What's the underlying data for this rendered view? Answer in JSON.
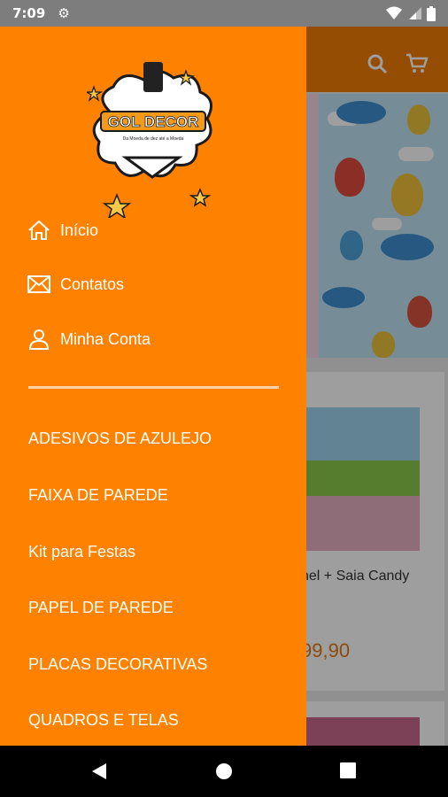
{
  "status_bar": {
    "time": "7:09",
    "icons": [
      "gear-icon",
      "wifi-icon",
      "signal-icon",
      "battery-icon"
    ]
  },
  "toolbar": {
    "icons": [
      "search-icon",
      "cart-icon"
    ]
  },
  "background": {
    "product_title": "nel + Saia Candy",
    "product_price": "99,90"
  },
  "drawer": {
    "logo_text": "GOL DECOR",
    "logo_tagline": "Da Moeda de dez até a Moeda",
    "nav": [
      {
        "label": "Início",
        "icon": "home-icon"
      },
      {
        "label": "Contatos",
        "icon": "mail-icon"
      },
      {
        "label": "Minha Conta",
        "icon": "person-icon"
      }
    ],
    "categories": [
      {
        "label": "ADESIVOS DE AZULEJO"
      },
      {
        "label": "FAIXA DE PAREDE"
      },
      {
        "label": "Kit para Festas"
      },
      {
        "label": "PAPEL DE PAREDE"
      },
      {
        "label": "PLACAS DECORATIVAS"
      },
      {
        "label": "QUADROS E TELAS"
      }
    ]
  },
  "colors": {
    "drawer_bg": "#ff8100",
    "toolbar_bg": "#f07d07",
    "price": "#e07a12"
  }
}
